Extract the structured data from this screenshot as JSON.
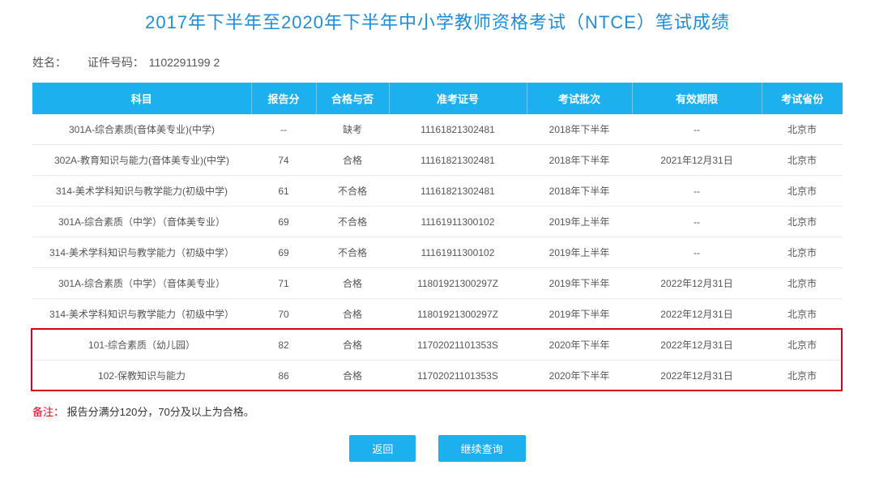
{
  "page": {
    "title": "2017年下半年至2020年下半年中小学教师资格考试（NTCE）笔试成绩"
  },
  "info": {
    "name_label": "姓名：",
    "name_value": "",
    "id_label": "证件号码：",
    "id_value": "1102291199            2"
  },
  "table": {
    "headers": {
      "subject": "科目",
      "score": "报告分",
      "pass": "合格与否",
      "ticket": "准考证号",
      "batch": "考试批次",
      "expire": "有效期限",
      "province": "考试省份"
    },
    "rows": [
      {
        "subject": "301A-综合素质(音体美专业)(中学)",
        "score": "--",
        "pass": "缺考",
        "ticket": "11161821302481",
        "batch": "2018年下半年",
        "expire": "--",
        "province": "北京市",
        "hl": false
      },
      {
        "subject": "302A-教育知识与能力(音体美专业)(中学)",
        "score": "74",
        "pass": "合格",
        "ticket": "11161821302481",
        "batch": "2018年下半年",
        "expire": "2021年12月31日",
        "province": "北京市",
        "hl": false
      },
      {
        "subject": "314-美术学科知识与教学能力(初级中学)",
        "score": "61",
        "pass": "不合格",
        "ticket": "11161821302481",
        "batch": "2018年下半年",
        "expire": "--",
        "province": "北京市",
        "hl": false
      },
      {
        "subject": "301A-综合素质（中学）（音体美专业）",
        "score": "69",
        "pass": "不合格",
        "ticket": "11161911300102",
        "batch": "2019年上半年",
        "expire": "--",
        "province": "北京市",
        "hl": false
      },
      {
        "subject": "314-美术学科知识与教学能力（初级中学）",
        "score": "69",
        "pass": "不合格",
        "ticket": "11161911300102",
        "batch": "2019年上半年",
        "expire": "--",
        "province": "北京市",
        "hl": false
      },
      {
        "subject": "301A-综合素质（中学）（音体美专业）",
        "score": "71",
        "pass": "合格",
        "ticket": "11801921300297Z",
        "batch": "2019年下半年",
        "expire": "2022年12月31日",
        "province": "北京市",
        "hl": false
      },
      {
        "subject": "314-美术学科知识与教学能力（初级中学）",
        "score": "70",
        "pass": "合格",
        "ticket": "11801921300297Z",
        "batch": "2019年下半年",
        "expire": "2022年12月31日",
        "province": "北京市",
        "hl": false
      },
      {
        "subject": "101-综合素质（幼儿园）",
        "score": "82",
        "pass": "合格",
        "ticket": "11702021101353S",
        "batch": "2020年下半年",
        "expire": "2022年12月31日",
        "province": "北京市",
        "hl": true
      },
      {
        "subject": "102-保教知识与能力",
        "score": "86",
        "pass": "合格",
        "ticket": "11702021101353S",
        "batch": "2020年下半年",
        "expire": "2022年12月31日",
        "province": "北京市",
        "hl": true
      }
    ]
  },
  "note": {
    "prefix": "备注：",
    "text": "报告分满分120分，70分及以上为合格。"
  },
  "buttons": {
    "back": "返回",
    "continue": "继续查询"
  }
}
